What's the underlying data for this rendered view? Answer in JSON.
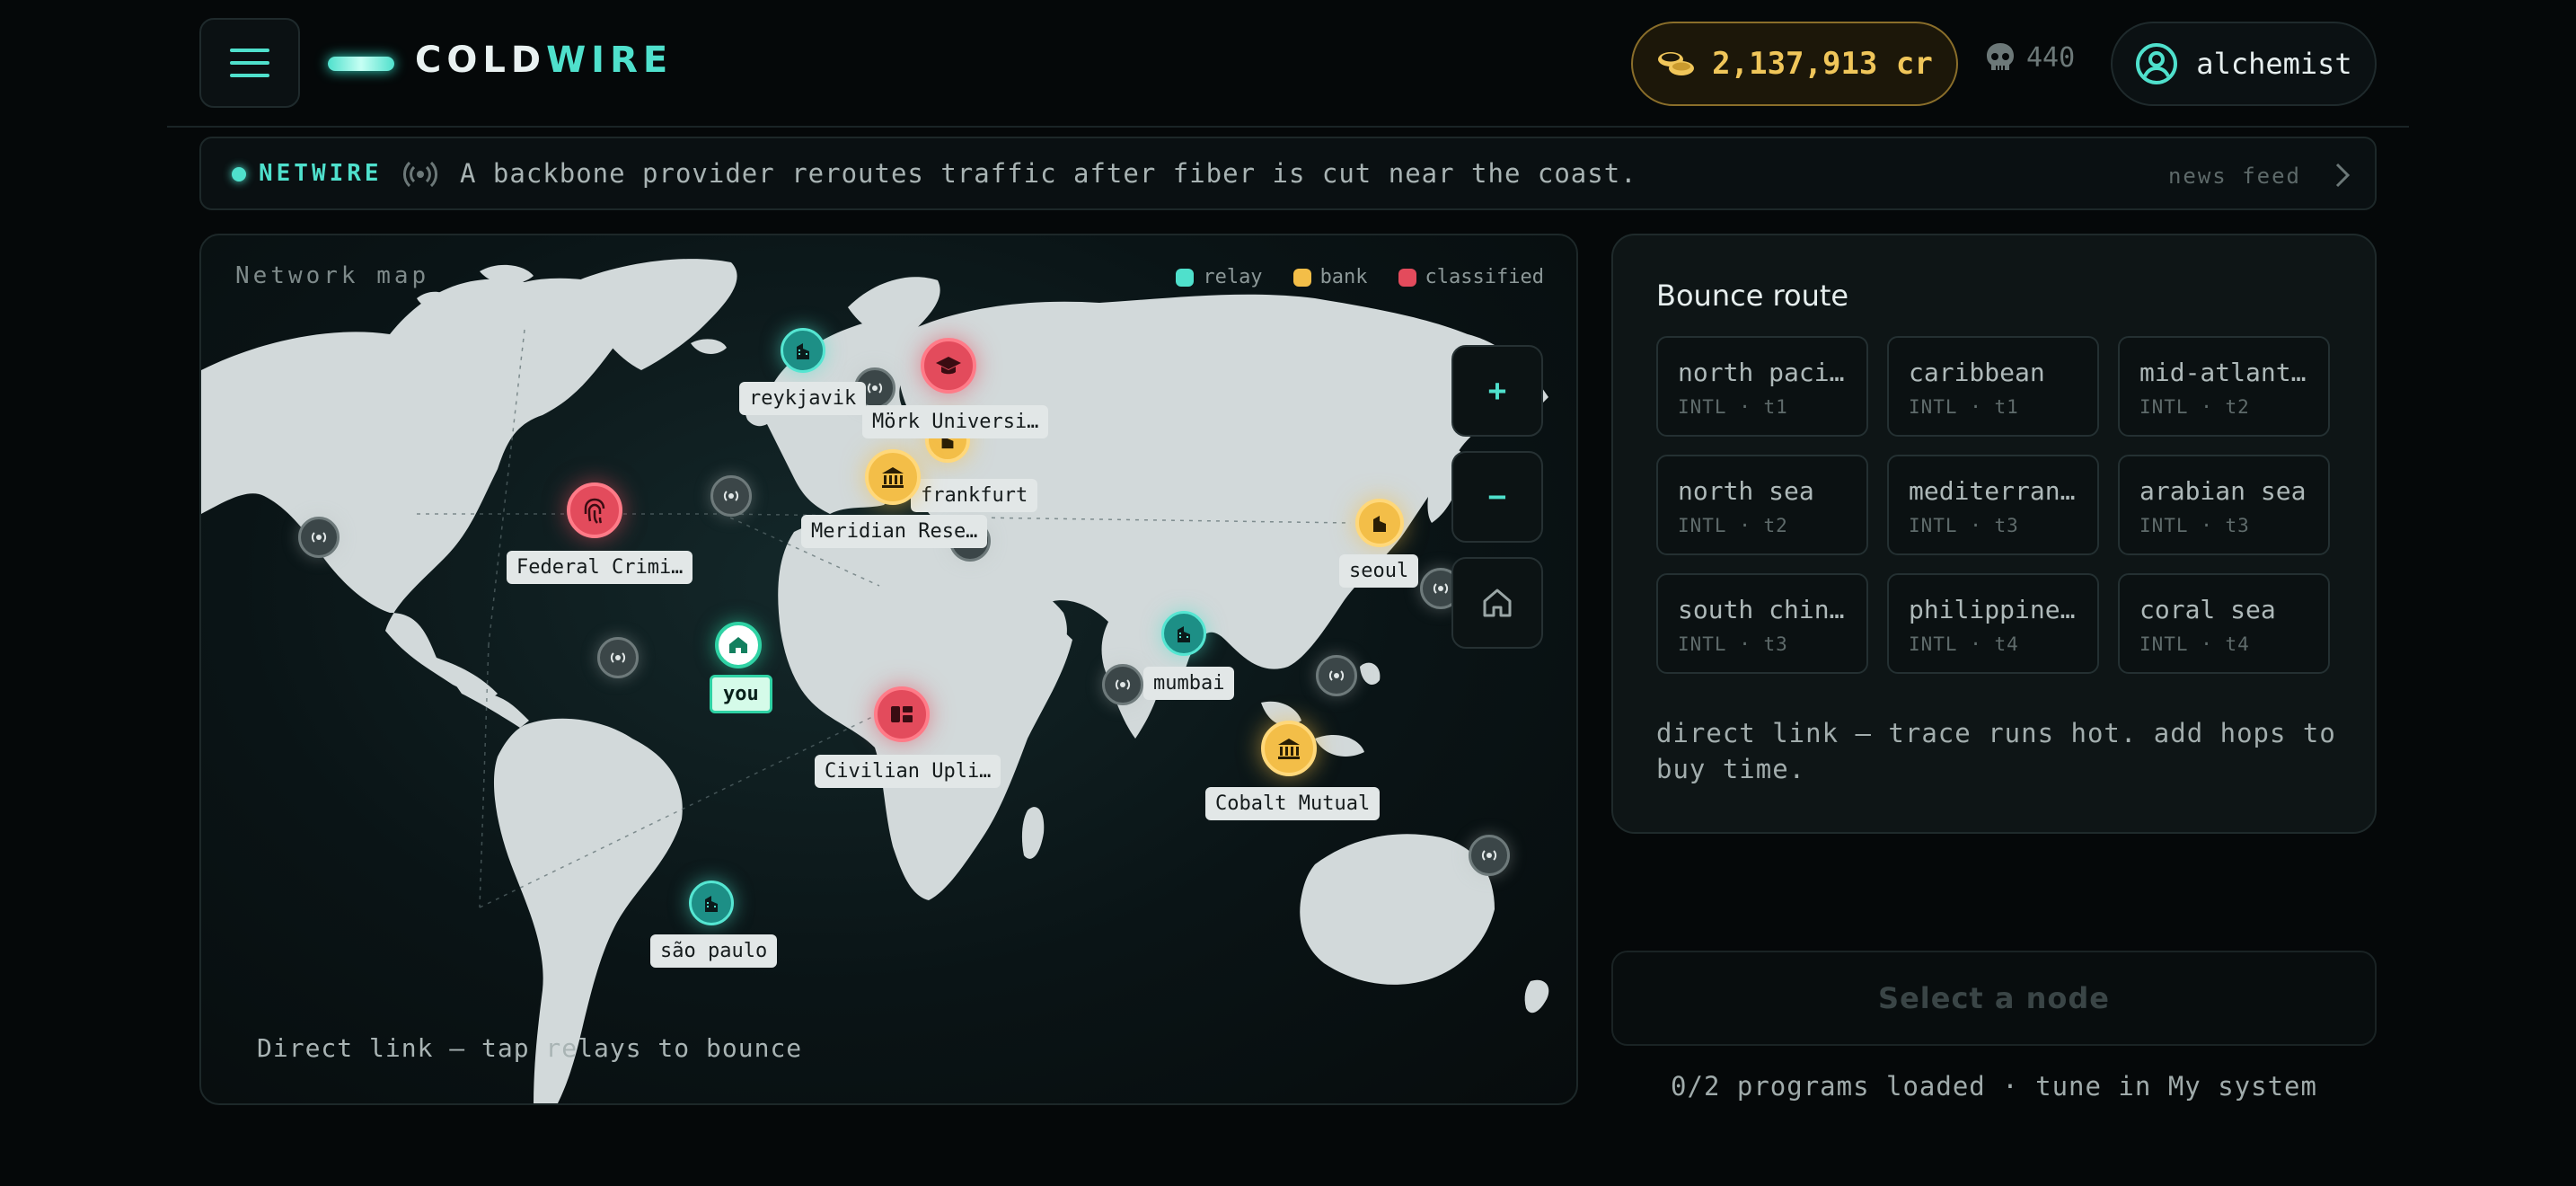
{
  "header": {
    "menu_icon": "hamburger-menu-icon",
    "logo_part1": "COLD",
    "logo_part2": "WIRE",
    "credits": "2,137,913 cr",
    "credits_icon": "coins-icon",
    "kills": "440",
    "kills_icon": "skull-icon",
    "username": "alchemist",
    "user_icon": "user-avatar-icon"
  },
  "ticker": {
    "label": "NETWIRE",
    "text": "A backbone provider reroutes traffic after fiber is cut near the coast.",
    "feed_link": "news feed"
  },
  "map": {
    "title": "Network map",
    "legend": [
      {
        "label": "relay",
        "color": "#4fe0cc"
      },
      {
        "label": "bank",
        "color": "#f3be48"
      },
      {
        "label": "classified",
        "color": "#e34b5c"
      }
    ],
    "hint": "Direct link — tap relays to bounce",
    "zoom_in": "+",
    "zoom_out": "−",
    "nodes": {
      "reykjavik": "reykjavik",
      "mork": "Mörk Universi…",
      "frankfurt": "frankfurt",
      "meridian": "Meridian Rese…",
      "federal": "Federal Crimi…",
      "seoul": "seoul",
      "you": "you",
      "mumbai": "mumbai",
      "civilian": "Civilian Upli…",
      "cobalt": "Cobalt Mutual",
      "sao_paulo": "são paulo"
    }
  },
  "route": {
    "title": "Bounce route",
    "hops": [
      {
        "name": "north paci…",
        "meta": "INTL · t1"
      },
      {
        "name": "caribbean",
        "meta": "INTL · t1"
      },
      {
        "name": "mid-atlant…",
        "meta": "INTL · t2"
      },
      {
        "name": "north sea",
        "meta": "INTL · t2"
      },
      {
        "name": "mediterran…",
        "meta": "INTL · t3"
      },
      {
        "name": "arabian sea",
        "meta": "INTL · t3"
      },
      {
        "name": "south chin…",
        "meta": "INTL · t3"
      },
      {
        "name": "philippine…",
        "meta": "INTL · t4"
      },
      {
        "name": "coral sea",
        "meta": "INTL · t4"
      }
    ],
    "note": "direct link — trace runs hot. add hops to buy time."
  },
  "select_button": "Select a node",
  "programs_status": "0/2 programs loaded · tune in My system"
}
